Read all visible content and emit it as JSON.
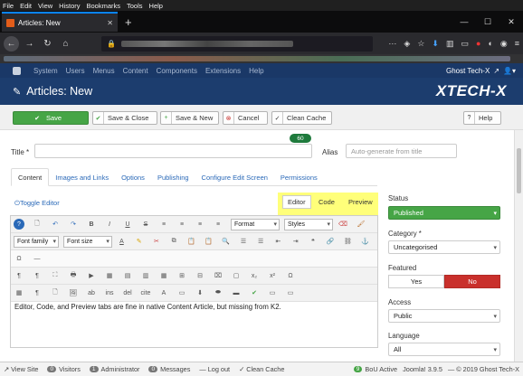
{
  "browser": {
    "menu": [
      "File",
      "Edit",
      "View",
      "History",
      "Bookmarks",
      "Tools",
      "Help"
    ],
    "tab_title": "Articles: New",
    "new_tab": "+",
    "window_controls": [
      "—",
      "☐",
      "✕"
    ]
  },
  "admin": {
    "menu": [
      "System",
      "Users",
      "Menus",
      "Content",
      "Components",
      "Extensions",
      "Help"
    ],
    "site_name": "Ghost Tech-X",
    "page_title": "Articles: New",
    "brand": "XTECH-X"
  },
  "toolbar": {
    "save": "Save",
    "save_close": "Save & Close",
    "save_new": "Save & New",
    "cancel": "Cancel",
    "clean_cache": "Clean Cache",
    "help": "Help"
  },
  "form": {
    "title_label": "Title *",
    "title_count": "60",
    "alias_label": "Alias",
    "alias_placeholder": "Auto-generate from title",
    "tabs": [
      "Content",
      "Images and Links",
      "Options",
      "Publishing",
      "Configure Edit Screen",
      "Permissions"
    ],
    "toggle_editor": "Toggle Editor",
    "editor_tabs": [
      "Editor",
      "Code",
      "Preview"
    ],
    "format": "Format",
    "styles": "Styles",
    "font_family": "Font family",
    "font_size": "Font size",
    "content_text": "Editor, Code, and Preview tabs are fine in native Content Article, but missing from K2."
  },
  "sidebar": {
    "status_label": "Status",
    "status_value": "Published",
    "category_label": "Category *",
    "category_value": "Uncategorised",
    "featured_label": "Featured",
    "featured_yes": "Yes",
    "featured_no": "No",
    "access_label": "Access",
    "access_value": "Public",
    "language_label": "Language",
    "language_value": "All"
  },
  "statusbar": {
    "view_site": "View Site",
    "visitors_count": "0",
    "visitors": "Visitors",
    "admin_count": "1",
    "administrator": "Administrator",
    "messages_count": "0",
    "messages": "Messages",
    "log_out": "Log out",
    "clean_cache": "Clean Cache",
    "bou_count": "9",
    "bou_active": "BoU Active",
    "version": "Joomla! 3.9.5",
    "copyright": "— © 2019 Ghost Tech-X"
  }
}
